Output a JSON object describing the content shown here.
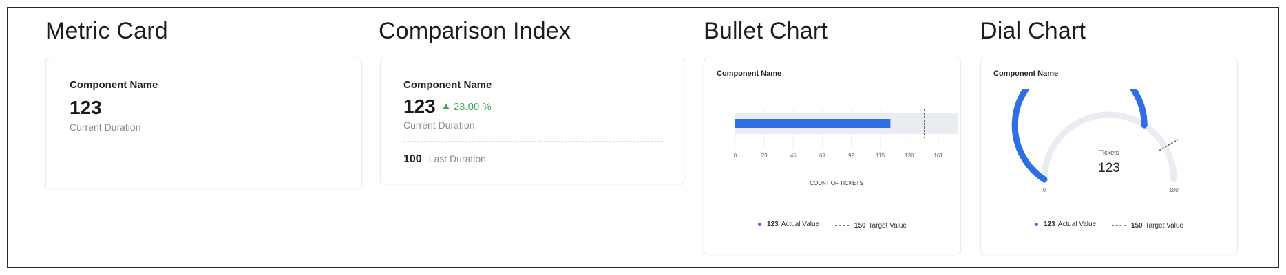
{
  "sections": {
    "metric_card": "Metric Card",
    "comparison_index": "Comparison Index",
    "bullet_chart": "Bullet Chart",
    "dial_chart": "Dial Chart"
  },
  "metric_card": {
    "component_name": "Component Name",
    "value": "123",
    "sub_label": "Current Duration"
  },
  "comparison_card": {
    "component_name": "Component Name",
    "value": "123",
    "trend": "23.00 %",
    "sub_label": "Current Duration",
    "last_value": "100",
    "last_label": "Last Duration"
  },
  "bullet_card": {
    "component_name": "Component Name",
    "legend": {
      "actual_value": "123",
      "actual_label": "Actual Value",
      "target_value": "150",
      "target_label": "Target Value"
    }
  },
  "dial_card": {
    "component_name": "Component Name",
    "center_label": "Tickets",
    "center_value": "123",
    "min_label": "0",
    "max_label": "180",
    "legend": {
      "actual_value": "123",
      "actual_label": "Actual Value",
      "target_value": "150",
      "target_label": "Target Value"
    }
  },
  "colors": {
    "accent": "#2f6fe4",
    "track": "#e9ecf0",
    "trend_up": "#3aa757"
  },
  "chart_data": [
    {
      "type": "bar",
      "orientation": "horizontal",
      "actual": 123,
      "target": 150,
      "xlim": [
        0,
        161
      ],
      "ticks": [
        "0",
        "23",
        "46",
        "69",
        "92",
        "115",
        "138",
        "161"
      ],
      "xlabel": "COUNT OF TICKETS"
    },
    {
      "type": "gauge",
      "actual": 123,
      "target": 150,
      "range": [
        0,
        180
      ]
    }
  ]
}
